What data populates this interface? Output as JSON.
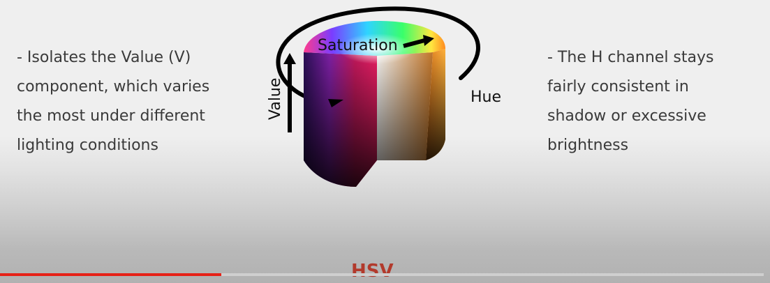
{
  "slide": {
    "left_text": [
      " - Isolates the Value (V)",
      "component, which varies",
      "the most under different",
      "lighting conditions"
    ],
    "right_text": [
      " - The H channel stays",
      "fairly consistent in",
      "shadow or excessive",
      "brightness"
    ],
    "diagram": {
      "saturation_label": "Saturation",
      "value_label": "Value",
      "hue_label": "Hue"
    },
    "caption": "HSV"
  },
  "video_player": {
    "progress_fraction": 0.29,
    "played_color": "#e62117",
    "track_color": "#cfcfcf"
  },
  "colors": {
    "text": "#3a3a3a",
    "caption": "#b23a2c"
  }
}
